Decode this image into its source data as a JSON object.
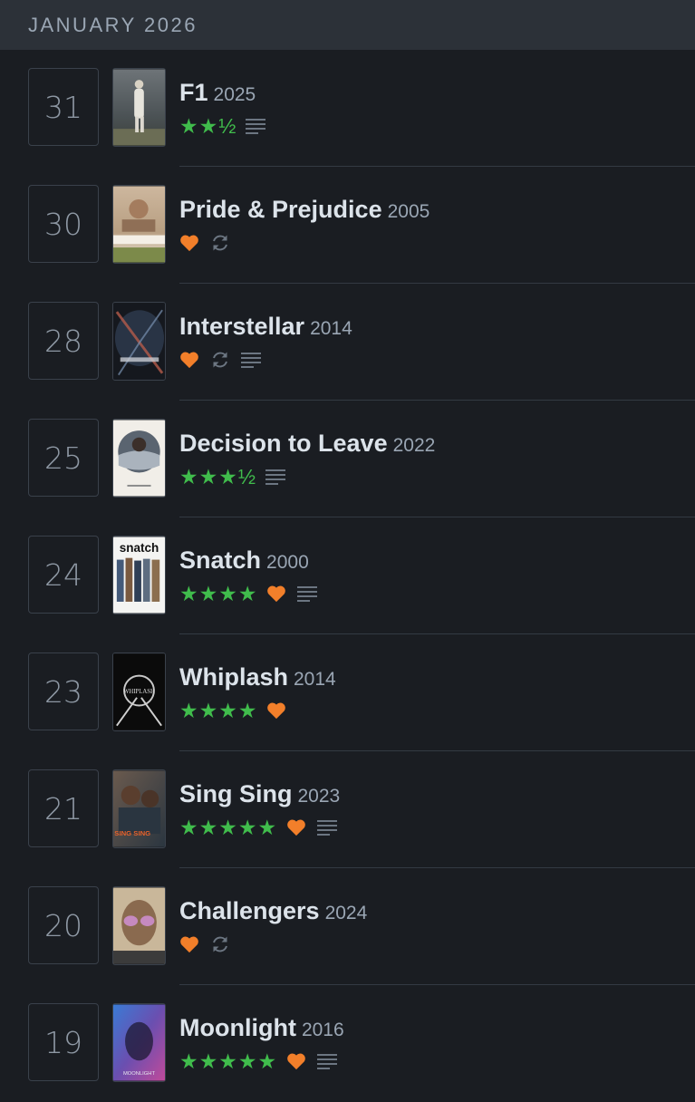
{
  "header": {
    "month": "JANUARY 2026"
  },
  "entries": [
    {
      "day": "31",
      "title": "F1",
      "year": "2025",
      "stars": "★★½",
      "liked": false,
      "rewatch": false,
      "review": true
    },
    {
      "day": "30",
      "title": "Pride & Prejudice",
      "year": "2005",
      "stars": "",
      "liked": true,
      "rewatch": true,
      "review": false
    },
    {
      "day": "28",
      "title": "Interstellar",
      "year": "2014",
      "stars": "",
      "liked": true,
      "rewatch": true,
      "review": true
    },
    {
      "day": "25",
      "title": "Decision to Leave",
      "year": "2022",
      "stars": "★★★½",
      "liked": false,
      "rewatch": false,
      "review": true
    },
    {
      "day": "24",
      "title": "Snatch",
      "year": "2000",
      "stars": "★★★★",
      "liked": true,
      "rewatch": false,
      "review": true
    },
    {
      "day": "23",
      "title": "Whiplash",
      "year": "2014",
      "stars": "★★★★",
      "liked": true,
      "rewatch": false,
      "review": false
    },
    {
      "day": "21",
      "title": "Sing Sing",
      "year": "2023",
      "stars": "★★★★★",
      "liked": true,
      "rewatch": false,
      "review": true
    },
    {
      "day": "20",
      "title": "Challengers",
      "year": "2024",
      "stars": "",
      "liked": true,
      "rewatch": true,
      "review": false
    },
    {
      "day": "19",
      "title": "Moonlight",
      "year": "2016",
      "stars": "★★★★★",
      "liked": true,
      "rewatch": false,
      "review": true
    }
  ],
  "posters": {
    "snatch_text": "snatch",
    "whiplash_text": "WHIPLASH",
    "singsing_text": "SING SING",
    "moonlight_text": "MOONLIGHT"
  },
  "colors": {
    "stars": "#40bc4c",
    "heart": "#f27f2a",
    "icon_gray": "#6c7682"
  }
}
